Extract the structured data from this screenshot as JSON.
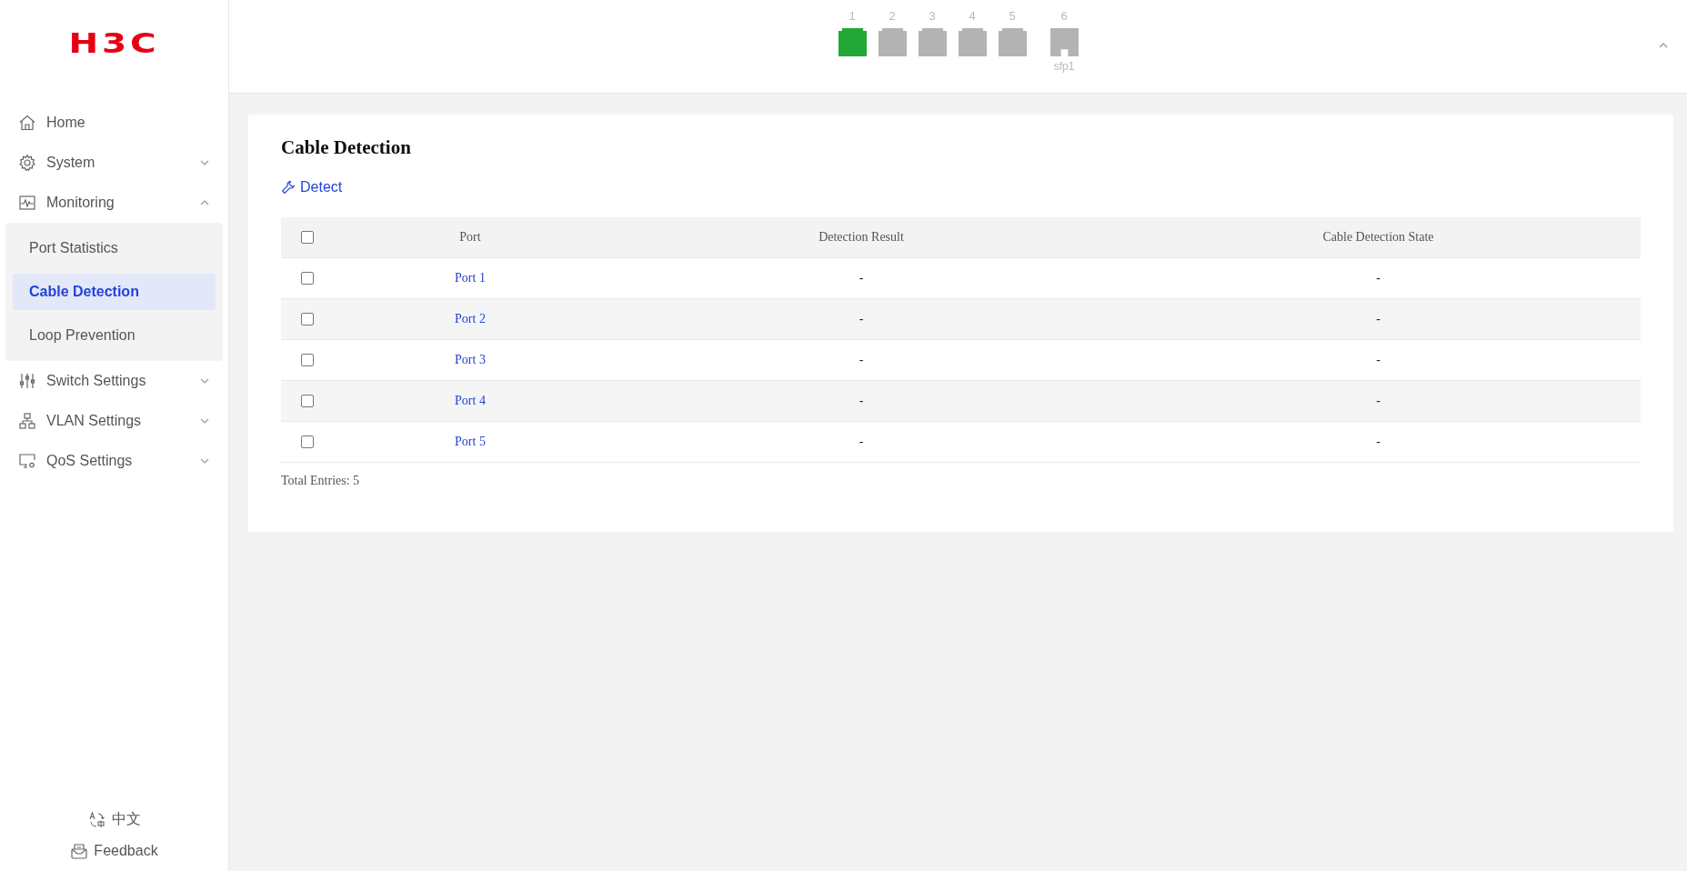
{
  "brand": {
    "logo": "H3C"
  },
  "sidebar": {
    "items": [
      {
        "label": "Home"
      },
      {
        "label": "System",
        "expanded": false
      },
      {
        "label": "Monitoring",
        "expanded": true,
        "children": [
          {
            "label": "Port Statistics",
            "selected": false
          },
          {
            "label": "Cable Detection",
            "selected": true
          },
          {
            "label": "Loop Prevention",
            "selected": false
          }
        ]
      },
      {
        "label": "Switch Settings",
        "expanded": false
      },
      {
        "label": "VLAN Settings",
        "expanded": false
      },
      {
        "label": "QoS Settings",
        "expanded": false
      }
    ],
    "language": "中文",
    "feedback": "Feedback"
  },
  "ports": [
    {
      "number": "1",
      "kind": "rj45",
      "linked": true
    },
    {
      "number": "2",
      "kind": "rj45",
      "linked": false
    },
    {
      "number": "3",
      "kind": "rj45",
      "linked": false
    },
    {
      "number": "4",
      "kind": "rj45",
      "linked": false
    },
    {
      "number": "5",
      "kind": "rj45",
      "linked": false
    },
    {
      "number": "6",
      "kind": "sfp",
      "linked": false,
      "caption": "sfp1"
    }
  ],
  "page": {
    "title": "Cable Detection",
    "action": "Detect"
  },
  "table": {
    "all_checked": false,
    "columns": [
      "Port",
      "Detection Result",
      "Cable Detection State"
    ],
    "rows": [
      {
        "checked": false,
        "port": "Port 1",
        "result": "-",
        "state": "-"
      },
      {
        "checked": false,
        "port": "Port 2",
        "result": "-",
        "state": "-"
      },
      {
        "checked": false,
        "port": "Port 3",
        "result": "-",
        "state": "-"
      },
      {
        "checked": false,
        "port": "Port 4",
        "result": "-",
        "state": "-"
      },
      {
        "checked": false,
        "port": "Port 5",
        "result": "-",
        "state": "-"
      }
    ],
    "footer": "Total Entries: 5"
  }
}
